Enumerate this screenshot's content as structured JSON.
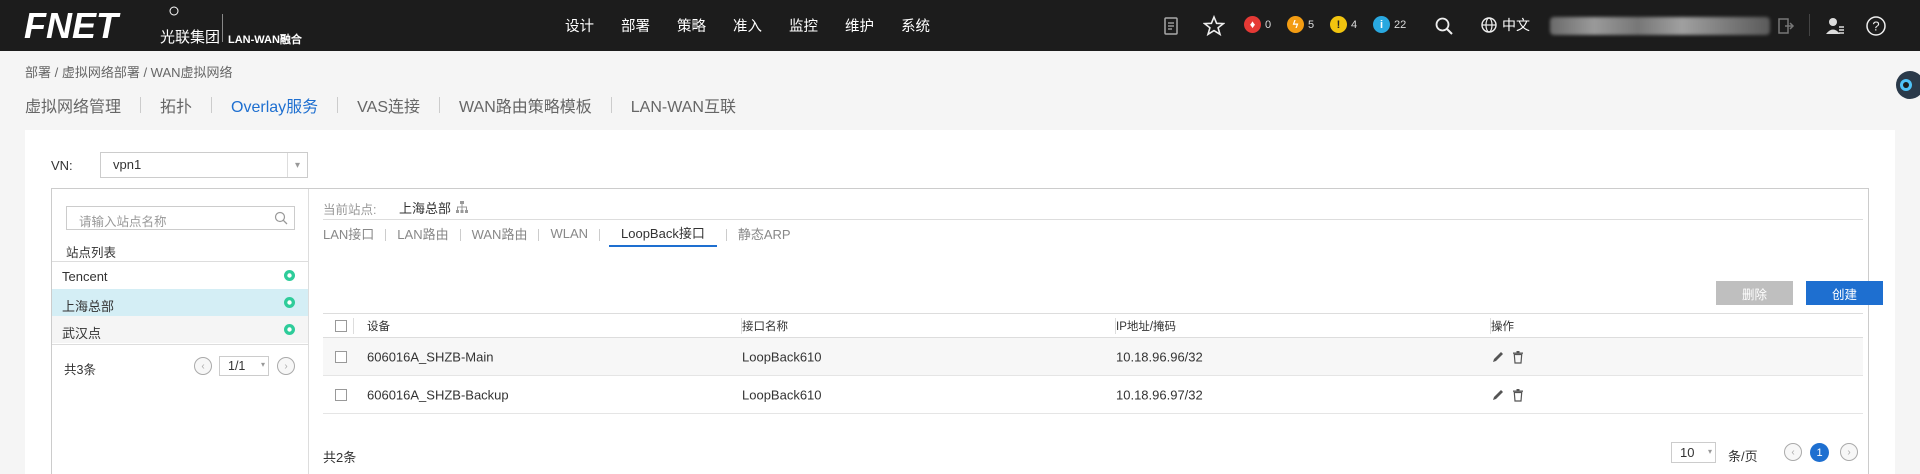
{
  "app": {
    "brand": "FNET",
    "brand_cn": "光联集团",
    "brand_sub": "LAN-WAN融合"
  },
  "main_nav": [
    "设计",
    "部署",
    "策略",
    "准入",
    "监控",
    "维护",
    "系统"
  ],
  "alarms": [
    {
      "count": "0",
      "color": "#e53935"
    },
    {
      "count": "5",
      "color": "#f39c12"
    },
    {
      "count": "4",
      "color": "#f1c40f"
    },
    {
      "count": "22",
      "color": "#29a8e0"
    }
  ],
  "language": "中文",
  "breadcrumb": "部署 / 虚拟网络部署 / WAN虚拟网络",
  "tabs": [
    {
      "label": "虚拟网络管理"
    },
    {
      "label": "拓扑"
    },
    {
      "label": "Overlay服务",
      "active": true
    },
    {
      "label": "VAS连接"
    },
    {
      "label": "WAN路由策略模板"
    },
    {
      "label": "LAN-WAN互联"
    }
  ],
  "vn": {
    "label": "VN:",
    "value": "vpn1"
  },
  "sites": {
    "search_placeholder": "请输入站点名称",
    "list_title": "站点列表",
    "items": [
      {
        "name": "Tencent"
      },
      {
        "name": "上海总部",
        "selected": true
      },
      {
        "name": "武汉点"
      }
    ],
    "total": "共3条",
    "page": "1/1"
  },
  "detail": {
    "current_site_label": "当前站点:",
    "current_site": "上海总部",
    "subtabs": [
      {
        "label": "LAN接口"
      },
      {
        "label": "LAN路由"
      },
      {
        "label": "WAN路由"
      },
      {
        "label": "WLAN"
      },
      {
        "label": "LoopBack接口",
        "active": true
      },
      {
        "label": "静态ARP"
      }
    ],
    "delete_label": "删除",
    "create_label": "创建",
    "columns": [
      "设备",
      "接口名称",
      "IP地址/掩码",
      "操作"
    ],
    "rows": [
      {
        "device": "606016A_SHZB-Main",
        "interface": "LoopBack610",
        "ip": "10.18.96.96/32"
      },
      {
        "device": "606016A_SHZB-Backup",
        "interface": "LoopBack610",
        "ip": "10.18.96.97/32"
      }
    ],
    "total": "共2条",
    "page_size": "10",
    "page_size_label": "条/页",
    "current_page": "1"
  },
  "colors": {
    "accent": "#1e6fd0",
    "topbar": "#1c1c1c",
    "selected_row": "#d4eef5",
    "site_ok": "#2ecc9a"
  }
}
